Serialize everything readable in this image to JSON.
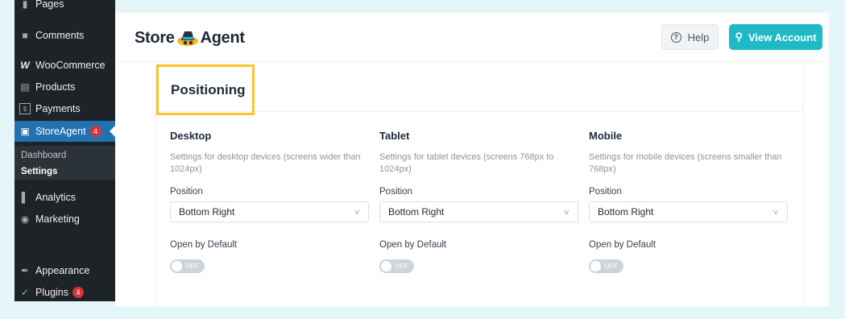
{
  "wp_sidebar": {
    "items": [
      {
        "label": "Pages",
        "icon": "pages-icon"
      },
      {
        "label": "Comments",
        "icon": "comments-icon"
      },
      {
        "label": "WooCommerce",
        "icon": "woocommerce-icon"
      },
      {
        "label": "Products",
        "icon": "products-icon"
      },
      {
        "label": "Payments",
        "icon": "payments-icon"
      },
      {
        "label": "StoreAgent",
        "icon": "storeagent-icon",
        "badge": "4",
        "active": true
      },
      {
        "label": "Analytics",
        "icon": "analytics-icon"
      },
      {
        "label": "Marketing",
        "icon": "marketing-icon"
      },
      {
        "label": "Appearance",
        "icon": "appearance-icon"
      },
      {
        "label": "Plugins",
        "icon": "plugins-icon",
        "badge": "4"
      }
    ],
    "submenu": [
      {
        "label": "Dashboard"
      },
      {
        "label": "Settings",
        "current": true
      }
    ]
  },
  "header": {
    "logo_left": "Store",
    "logo_right": "Agent",
    "help_label": "Help",
    "account_label": "View Account"
  },
  "card": {
    "title": "Positioning",
    "columns": [
      {
        "title": "Desktop",
        "description": "Settings for desktop devices (screens wider than 1024px)",
        "position_label": "Position",
        "position_value": "Bottom Right",
        "open_label": "Open by Default",
        "toggle_text": "OFF"
      },
      {
        "title": "Tablet",
        "description": "Settings for tablet devices (screens 768px to 1024px)",
        "position_label": "Position",
        "position_value": "Bottom Right",
        "open_label": "Open by Default",
        "toggle_text": "OFF"
      },
      {
        "title": "Mobile",
        "description": "Settings for mobile devices (screens smaller than 768px)",
        "position_label": "Position",
        "position_value": "Bottom Right",
        "open_label": "Open by Default",
        "toggle_text": "OFF"
      }
    ]
  },
  "colors": {
    "accent": "#1fbac6",
    "wp_active": "#2271b1",
    "highlight": "#fbc529",
    "badge": "#d63638"
  }
}
